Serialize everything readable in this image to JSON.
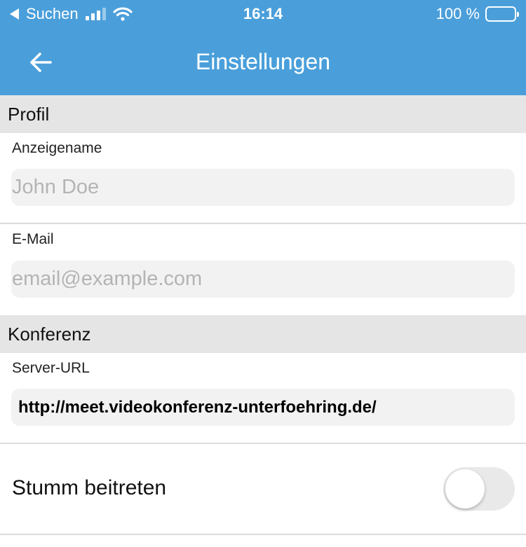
{
  "status_bar": {
    "back_app_label": "Suchen",
    "time": "16:14",
    "battery_text": "100 %"
  },
  "nav": {
    "title": "Einstellungen"
  },
  "sections": {
    "profile": {
      "title": "Profil",
      "display_name": {
        "label": "Anzeigename",
        "placeholder": "John Doe",
        "value": ""
      },
      "email": {
        "label": "E-Mail",
        "placeholder": "email@example.com",
        "value": ""
      }
    },
    "conference": {
      "title": "Konferenz",
      "server_url": {
        "label": "Server-URL",
        "value": "http://meet.videokonferenz-unterfoehring.de/"
      },
      "start_muted": {
        "label": "Stumm beitreten",
        "enabled": false
      }
    }
  },
  "colors": {
    "header_bg": "#4a9fda",
    "section_bg": "#e5e5e5",
    "input_bg": "#f2f2f2"
  }
}
